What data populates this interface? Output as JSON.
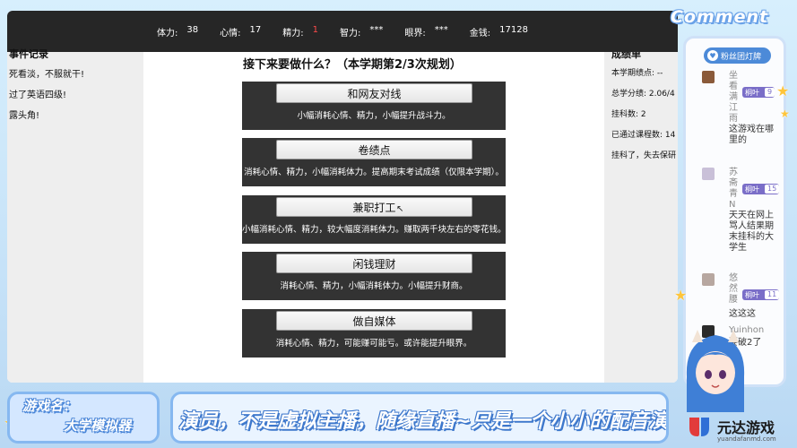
{
  "stats": [
    {
      "key": "体力:",
      "value": "38",
      "warn": false
    },
    {
      "key": "心情:",
      "value": "17",
      "warn": false
    },
    {
      "key": "精力:",
      "value": "1",
      "warn": true
    },
    {
      "key": "智力:",
      "value": "***",
      "warn": false
    },
    {
      "key": "眼界:",
      "value": "***",
      "warn": false
    },
    {
      "key": "金钱:",
      "value": "17128",
      "warn": false
    }
  ],
  "left_panel": {
    "heading": "事件记录",
    "lines": [
      "死看淡，不服就干!",
      "过了英语四级!",
      "露头角!"
    ]
  },
  "right_panel": {
    "heading": "成绩单",
    "lines": [
      "本学期绩点: --",
      "总学分绩: 2.06/4",
      "挂科数: 2",
      "已通过课程数: 14",
      "挂科了，失去保研"
    ]
  },
  "question": "接下来要做什么？（本学期第2/3次规划）",
  "options": [
    {
      "label": "和网友对线",
      "desc": "小幅消耗心情、精力，小幅提升战斗力。"
    },
    {
      "label": "卷绩点",
      "desc": "消耗心情、精力，小幅消耗体力。提高期末考试成绩（仅限本学期）。"
    },
    {
      "label": "兼职打工",
      "desc": "小幅消耗心情、精力，较大幅度消耗体力。赚取两千块左右的零花钱。"
    },
    {
      "label": "闲钱理财",
      "desc": "消耗心情、精力，小幅消耗体力。小幅提升财商。"
    },
    {
      "label": "做自媒体",
      "desc": "消耗心情、精力，可能赚可能亏。或许能提升眼界。"
    }
  ],
  "comment_title": "Comment",
  "fans_banner": "粉丝团灯牌",
  "comments": [
    {
      "name": "坐看满江雨",
      "badge_level": "9",
      "badge_name": "桐叶",
      "text": "这游戏在哪里的"
    },
    {
      "name": "苏斋青N",
      "badge_level": "15",
      "badge_name": "桐叶",
      "text": "天天在网上骂人结果期末挂科的大学生"
    },
    {
      "name": "悠然腰",
      "badge_level": "11",
      "badge_name": "桐叶",
      "text": "这这这"
    },
    {
      "name": "Yuinhon",
      "badge_level": "",
      "badge_name": "",
      "text": "要破2了"
    }
  ],
  "game_name_label": "游戏名：",
  "game_name": "大学模拟器",
  "marquee": "演员，不是虚拟主播，随缘直播~只是一个小小的配音演员",
  "logo_brand": "元达游戏",
  "logo_domain": "yuandafanmd.com",
  "colors": {
    "status_bg": "#262626",
    "option_bg": "#333333",
    "warn": "#ff4a4a",
    "accent": "#4c8ad8"
  }
}
